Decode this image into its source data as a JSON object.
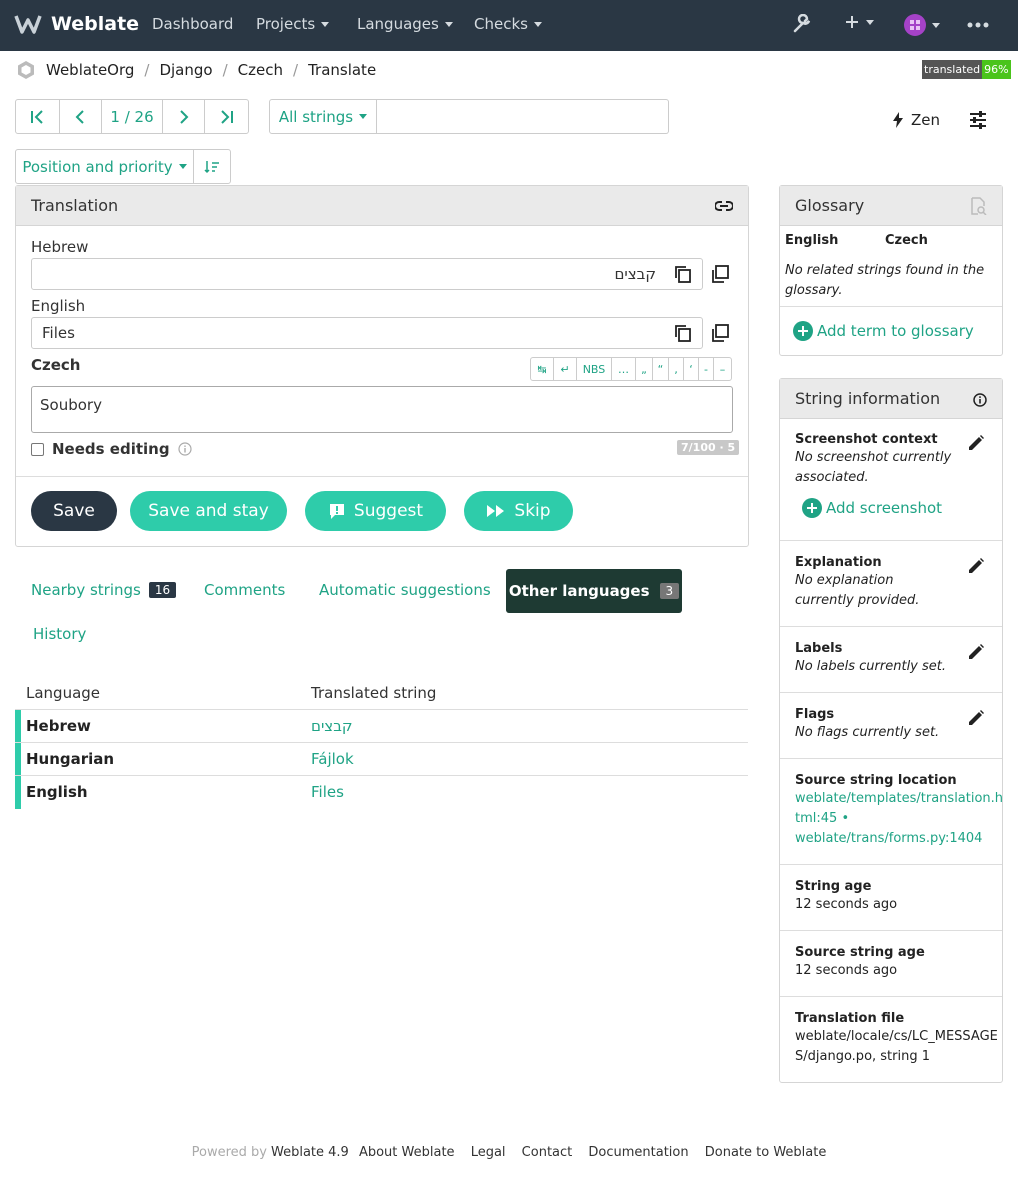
{
  "nav": {
    "brand": "Weblate",
    "items": [
      "Dashboard",
      "Projects",
      "Languages",
      "Checks"
    ]
  },
  "breadcrumb": [
    "WeblateOrg",
    "Django",
    "Czech",
    "Translate"
  ],
  "badge": {
    "label": "translated",
    "value": "96%"
  },
  "toolbar": {
    "position": "1 / 26",
    "filter": "All strings",
    "search_value": "",
    "zen": "Zen",
    "sort": "Position and priority"
  },
  "translation": {
    "title": "Translation",
    "source_lang": "Hebrew",
    "source_text": "קבצים",
    "english_lang": "English",
    "english_text": "Files",
    "target_lang": "Czech",
    "target_text": "Soubory",
    "special_chars": [
      "↹",
      "↵",
      "NBS",
      "…",
      "„",
      "“",
      "‚",
      "‘",
      "-",
      "–"
    ],
    "needs_editing": "Needs editing",
    "counter": "7/100 · 5"
  },
  "buttons": {
    "save": "Save",
    "save_stay": "Save and stay",
    "suggest": "Suggest",
    "skip": "Skip"
  },
  "colors": {
    "dark": "#2a3744",
    "accent": "#2eccaa",
    "link": "#1fa385"
  },
  "tabs": {
    "nearby": "Nearby strings",
    "nearby_count": "16",
    "comments": "Comments",
    "auto": "Automatic suggestions",
    "other": "Other languages",
    "other_count": "3",
    "history": "History"
  },
  "table": {
    "headers": [
      "Language",
      "Translated string"
    ],
    "rows": [
      {
        "lang": "Hebrew",
        "text": "קבצים"
      },
      {
        "lang": "Hungarian",
        "text": "Fájlok"
      },
      {
        "lang": "English",
        "text": "Files"
      }
    ]
  },
  "glossary": {
    "title": "Glossary",
    "col1": "English",
    "col2": "Czech",
    "empty": "No related strings found in the glossary.",
    "add": "Add term to glossary"
  },
  "info": {
    "title": "String information",
    "screenshot_title": "Screenshot context",
    "screenshot_text": "No screenshot currently associated.",
    "add_screenshot": "Add screenshot",
    "explanation_title": "Explanation",
    "explanation_text": "No explanation currently provided.",
    "labels_title": "Labels",
    "labels_text": "No labels currently set.",
    "flags_title": "Flags",
    "flags_text": "No flags currently set.",
    "location_title": "Source string location",
    "location_1a": "weblate/templates/translation.h",
    "location_1b": "tml:45",
    "location_sep": "•",
    "location_2": "weblate/trans/forms.py:1404",
    "age_title": "String age",
    "age_text": "12 seconds ago",
    "src_age_title": "Source string age",
    "src_age_text": "12 seconds ago",
    "file_title": "Translation file",
    "file_1": "weblate/locale/cs/LC_MESSAGE",
    "file_2": "S/django.po, string 1"
  },
  "footer": {
    "powered": "Powered by",
    "version": "Weblate 4.9",
    "links": [
      "About Weblate",
      "Legal",
      "Contact",
      "Documentation",
      "Donate to Weblate"
    ]
  }
}
